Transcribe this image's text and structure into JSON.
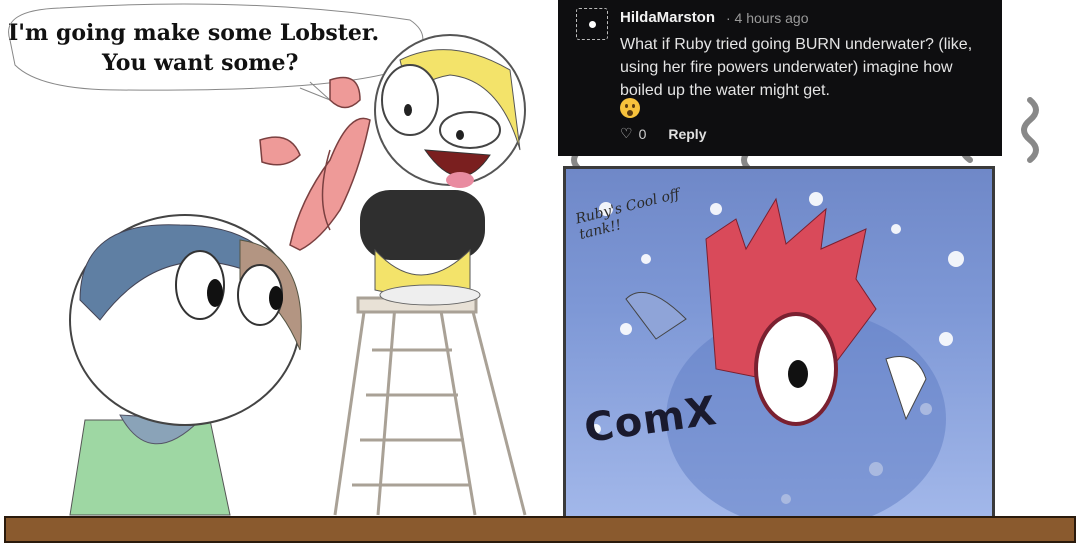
{
  "speech": {
    "line1": "I'm going make some Lobster.",
    "line2": "You want some?"
  },
  "comment": {
    "username": "HildaMarston",
    "time": "· 4 hours ago",
    "text": "What if Ruby tried going BURN underwater? (like, using her fire powers underwater) imagine how boiled up the water might get.",
    "emoji": "astonished-face-emoji",
    "likes": "0",
    "reply_label": "Reply"
  },
  "tank": {
    "label": "Ruby's Cool off tank!!",
    "signature": "ComX"
  },
  "colors": {
    "comment_bg": "#0e0e10",
    "water": "#7e98d6",
    "table": "#8a5a2e",
    "hair_red": "#d94a5a",
    "hair_yellow": "#f3e36a"
  }
}
